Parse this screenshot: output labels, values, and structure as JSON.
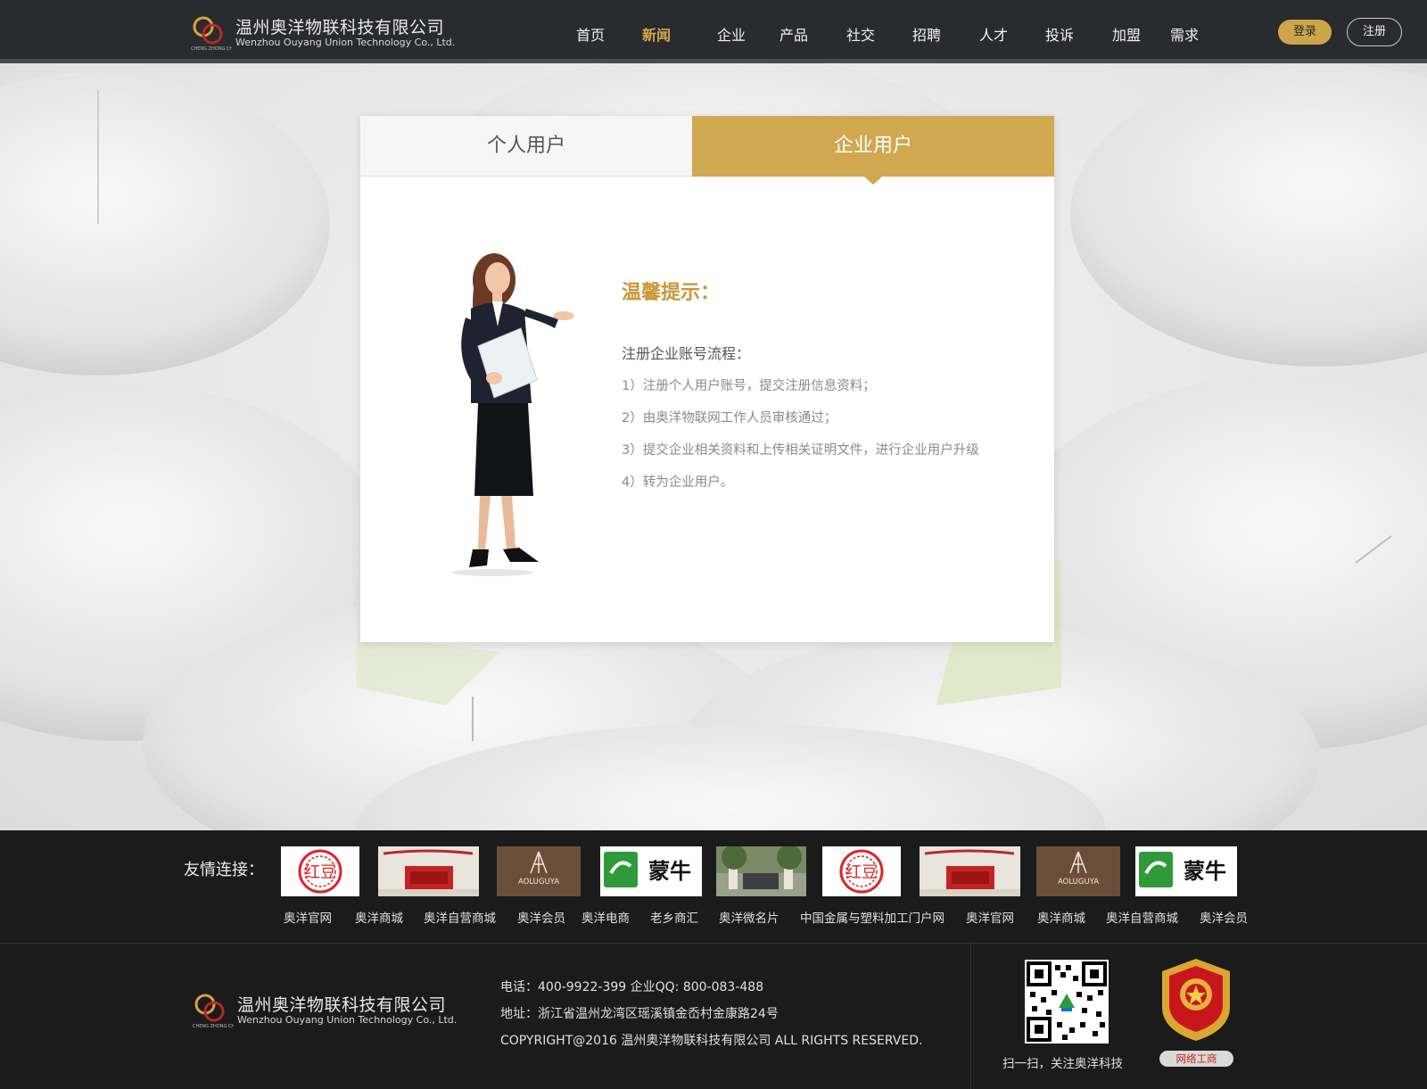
{
  "header": {
    "company_cn": "温州奥洋物联科技有限公司",
    "company_en": "Wenzhou Ouyang Union Technology Co., Ltd.",
    "nav": [
      {
        "label": "首页",
        "active": false
      },
      {
        "label": "新闻",
        "active": true
      },
      {
        "label": "企业",
        "active": false
      },
      {
        "label": "产品",
        "active": false
      },
      {
        "label": "社交",
        "active": false
      },
      {
        "label": "招聘",
        "active": false
      },
      {
        "label": "人才",
        "active": false
      },
      {
        "label": "投诉",
        "active": false
      },
      {
        "label": "加盟",
        "active": false
      },
      {
        "label": "需求",
        "active": false
      }
    ],
    "login_label": "登录",
    "register_label": "注册"
  },
  "card": {
    "tabs": {
      "personal": "个人用户",
      "enterprise": "企业用户",
      "active": "enterprise"
    },
    "tip_title": "温馨提示：",
    "intro": "注册企业账号流程：",
    "steps": [
      "1）注册个人用户账号，提交注册信息资料；",
      "2）由奥洋物联网工作人员审核通过；",
      "3）提交企业相关资料和上传相关证明文件，进行企业用户升级",
      "4）转为企业用户。"
    ]
  },
  "friend_links": {
    "title": "友情连接：",
    "logos": [
      {
        "name": "hongdou",
        "text": "红豆"
      },
      {
        "name": "storefront-banner",
        "text": ""
      },
      {
        "name": "aoluguya",
        "text": "AOLUGUYA"
      },
      {
        "name": "mengniu",
        "text": "蒙牛"
      },
      {
        "name": "gate-photo",
        "text": ""
      },
      {
        "name": "hongdou",
        "text": "红豆"
      },
      {
        "name": "storefront-banner",
        "text": ""
      },
      {
        "name": "aoluguya",
        "text": "AOLUGUYA"
      },
      {
        "name": "mengniu",
        "text": "蒙牛"
      }
    ],
    "labels": [
      "奥洋官网",
      "奥洋商城",
      "奥洋自营商城",
      "奥洋会员",
      "奥洋电商",
      "老乡商汇",
      "奥洋微名片",
      "中国金属与塑料加工门户网",
      "奥洋官网",
      "奥洋商城",
      "奥洋自营商城",
      "奥洋会员"
    ]
  },
  "footer": {
    "company_cn": "温州奥洋物联科技有限公司",
    "company_en": "Wenzhou Ouyang Union Technology Co., Ltd.",
    "phone_line": "电话：400-9922-399    企业QQ: 800-083-488",
    "address_line": "地址：浙江省温州龙湾区瑶溪镇金岙村金康路24号",
    "copyright_line": "COPYRIGHT@2016 温州奥洋物联科技有限公司 ALL RIGHTS RESERVED.",
    "qr_caption": "扫一扫，关注奥洋科技",
    "badge_label": "网络工商"
  },
  "colors": {
    "accent_gold": "#cfa850",
    "nav_active": "#d4a94b",
    "header_bg": "#2a2b2e",
    "footer_bg": "#1b1b1b",
    "tip_title": "#c9973a"
  }
}
